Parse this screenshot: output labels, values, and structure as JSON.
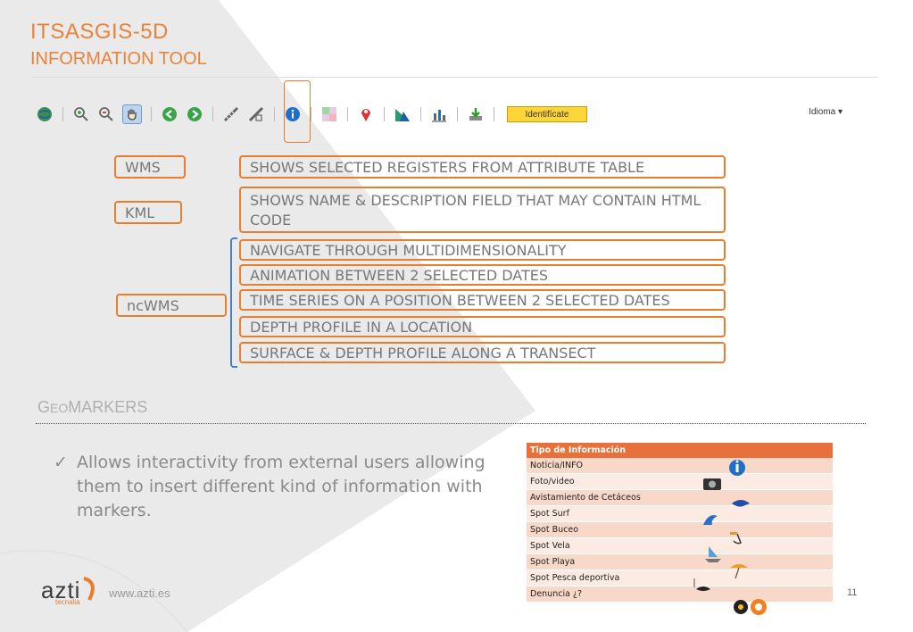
{
  "header": {
    "title": "ITSASGIS-5D",
    "subtitle": "INFORMATION TOOL"
  },
  "toolbar": {
    "buttons": [
      {
        "icon": "globe-icon"
      },
      {
        "icon": "zoom-in-icon"
      },
      {
        "icon": "zoom-out-icon"
      },
      {
        "icon": "pan-hand-icon"
      },
      {
        "icon": "back-arrow-icon"
      },
      {
        "icon": "forward-arrow-icon"
      },
      {
        "icon": "measure-line-icon"
      },
      {
        "icon": "measure-area-icon"
      },
      {
        "icon": "info-icon"
      },
      {
        "icon": "layers-icon"
      },
      {
        "icon": "marker-pin-icon"
      },
      {
        "icon": "profile-icon"
      },
      {
        "icon": "chart-icon"
      },
      {
        "icon": "download-icon"
      }
    ],
    "identify_label": "Identifícate",
    "language_label": "Idioma ▾"
  },
  "groups": [
    {
      "label": "WMS"
    },
    {
      "label": "KML"
    },
    {
      "label": "ncWMS"
    }
  ],
  "features": [
    "SHOWS SELECTED REGISTERS FROM ATTRIBUTE TABLE",
    "SHOWS NAME & DESCRIPTION FIELD THAT MAY CONTAIN HTML CODE",
    "NAVIGATE THROUGH MULTIDIMENSIONALITY",
    "ANIMATION BETWEEN 2 SELECTED DATES",
    "TIME SERIES ON A POSITION BETWEEN 2 SELECTED DATES",
    "DEPTH PROFILE IN A LOCATION",
    "SURFACE & DEPTH PROFILE ALONG A TRANSECT"
  ],
  "geomarkers": {
    "heading_first": "G",
    "heading_small": "EO",
    "heading_rest": "MARKERS",
    "bullet": "Allows interactivity from external users allowing them to insert different kind of information with markers."
  },
  "info_table": {
    "header": "Tipo de Información",
    "rows": [
      "Noticia/INFO",
      "Foto/video",
      "Avistamiento de Cetáceos",
      "Spot Surf",
      "Spot Buceo",
      "Spot Vela",
      "Spot Playa",
      "Spot Pesca deportiva",
      "Denuncia ¿?"
    ]
  },
  "footer": {
    "logo": "azti",
    "logo_sub": "tecnalia",
    "url": "www.azti.es",
    "page": "11"
  },
  "colors": {
    "accent": "#e87d2e",
    "bracket": "#4a7fc1",
    "table_header": "#e8703a"
  }
}
